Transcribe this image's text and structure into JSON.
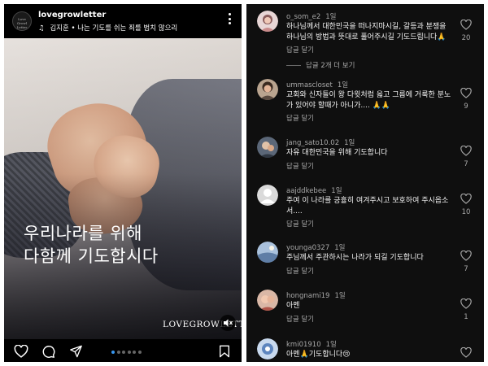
{
  "post": {
    "avatar_text": "Love Growl Letter",
    "username": "lovegrowletter",
    "music": {
      "artist": "김지훈",
      "separator": "•",
      "song": "나는 기도를 쉬는 죄를 범치 않으리"
    },
    "headline_line1": "우리나라를 위해",
    "headline_line2": "다함께 기도합시다",
    "watermark": "LOVEGROWLETTER",
    "carousel": {
      "total": 6,
      "active_index": 0
    },
    "actions": [
      "heart-icon",
      "comment-icon",
      "share-icon",
      "bookmark-icon"
    ]
  },
  "comments_panel": {
    "reply_label": "답글 달기",
    "view_replies": "답글 2개 더 보기",
    "items": [
      {
        "username": "o_som_e2",
        "age": "1일",
        "text": "하나님께서 대한민국을 떠나지마시길, 갈등과 분쟁을 하나님의 방법과 뜻대로 풀어주시길 기도드립니다🙏",
        "likes": "20",
        "avatar_color": "#c9a0a8"
      },
      {
        "username": "ummascloset",
        "age": "1일",
        "text": "교회와 신자들이 왕 다윗처럼 옳고 그름에 거룩한 분노가 있어야 할때가 아니가.... 🙏🙏",
        "likes": "9",
        "avatar_color": "#8a6e5a"
      },
      {
        "username": "jang_sato10.02",
        "age": "1일",
        "text": "자유 대한민국을 위해 기도합니다",
        "likes": "7",
        "avatar_color": "#6f7c8f"
      },
      {
        "username": "aajddkebee",
        "age": "1일",
        "text": "주여 이 나라를 긍휼히 여겨주시고 보호하여 주시옵소서....",
        "likes": "10",
        "avatar_color": "#d9d9d9"
      },
      {
        "username": "younga0327",
        "age": "1일",
        "text": "주님께서 주관하시는 나라가 되길 기도합니다",
        "likes": "7",
        "avatar_color": "#7d96b8"
      },
      {
        "username": "hongnami19",
        "age": "1일",
        "text": "아멘",
        "likes": "1",
        "avatar_color": "#c98a78"
      },
      {
        "username": "kmi01910",
        "age": "1일",
        "text": "아멘🙏기도합니다😢",
        "likes": "",
        "avatar_color": "#9bb5d6"
      }
    ]
  }
}
